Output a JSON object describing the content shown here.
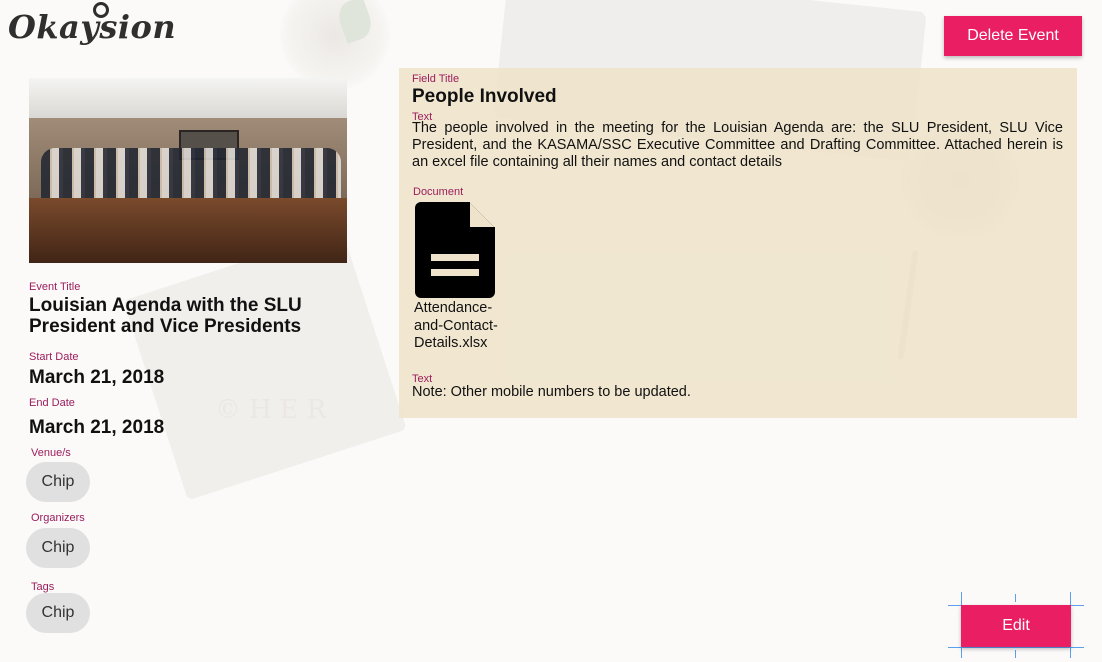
{
  "app": {
    "logo_text": "Okaysion"
  },
  "toolbar": {
    "delete_label": "Delete Event",
    "edit_label": "Edit"
  },
  "event": {
    "title_label": "Event Title",
    "title": "Louisian Agenda with the SLU President and Vice Presidents",
    "start_label": "Start Date",
    "start_date": "March 21, 2018",
    "end_label": "End Date",
    "end_date": "March 21, 2018",
    "venue_label": "Venue/s",
    "venue_chip": "Chip",
    "organizers_label": "Organizers",
    "organizers_chip": "Chip",
    "tags_label": "Tags",
    "tags_chip": "Chip"
  },
  "field": {
    "title_label": "Field Title",
    "title": "People Involved",
    "text_label": "Text",
    "text": "The people involved in the meeting for the Louisian Agenda are: the SLU President, SLU Vice President, and the KASAMA/SSC Executive Committee and Drafting Committee. Attached herein is an excel file containing all their names and contact details",
    "document_label": "Document",
    "document_name": "Attendance-and-Contact-Details.xlsx",
    "note_label": "Text",
    "note": "Note: Other mobile numbers to be updated."
  },
  "colors": {
    "accent": "#e91e63",
    "label": "#9b1d5c",
    "panel": "#efe4cb",
    "chip": "#e0e0e0"
  },
  "icons": {
    "document": "document-icon"
  }
}
